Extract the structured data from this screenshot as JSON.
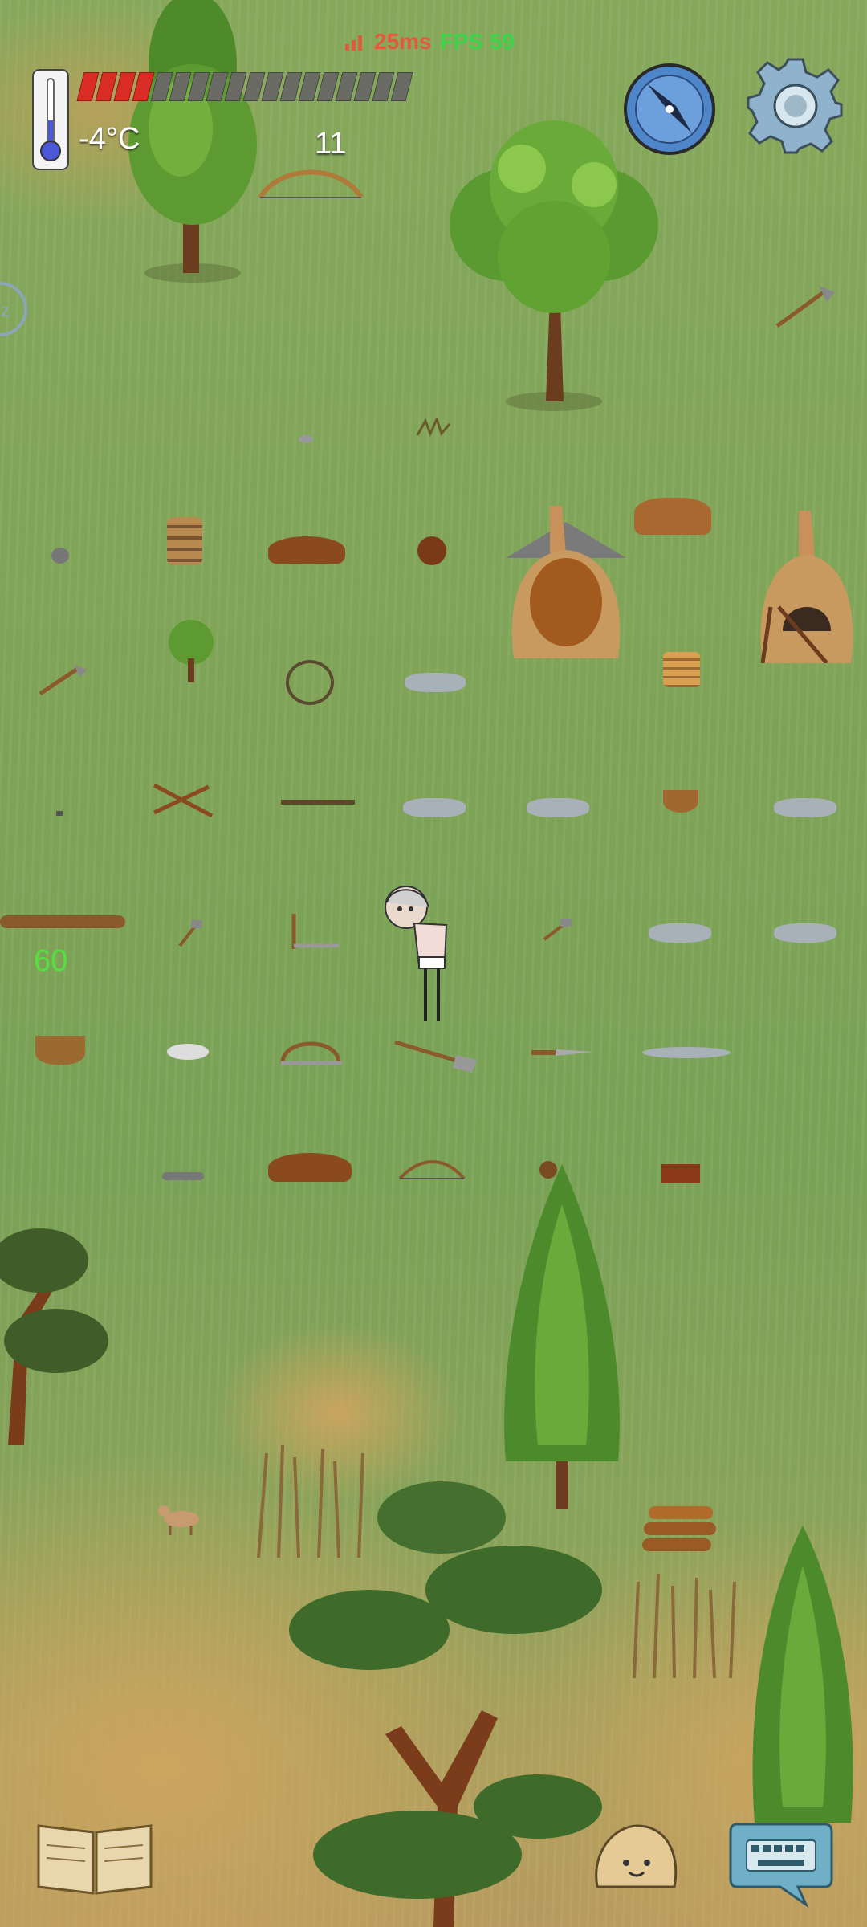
{
  "hud": {
    "temperature": "-4°C",
    "food": {
      "full": 4,
      "total": 18
    },
    "yum_count": "11",
    "ping": "25ms",
    "fps": "FPS 59"
  },
  "player": {
    "age": "60"
  },
  "icons": {
    "thermometer": "thermometer-icon",
    "signal": "signal-icon",
    "compass": "compass-icon",
    "settings": "gear-icon",
    "sleep": "sleep-icon",
    "tech_book": "book-icon",
    "emote": "emote-icon",
    "chat": "keyboard-icon"
  },
  "colors": {
    "food_full": "#d82c25",
    "food_empty": "#6b6b66",
    "ping": "#e05a3c",
    "fps": "#3dd44a",
    "age": "#56e040"
  }
}
